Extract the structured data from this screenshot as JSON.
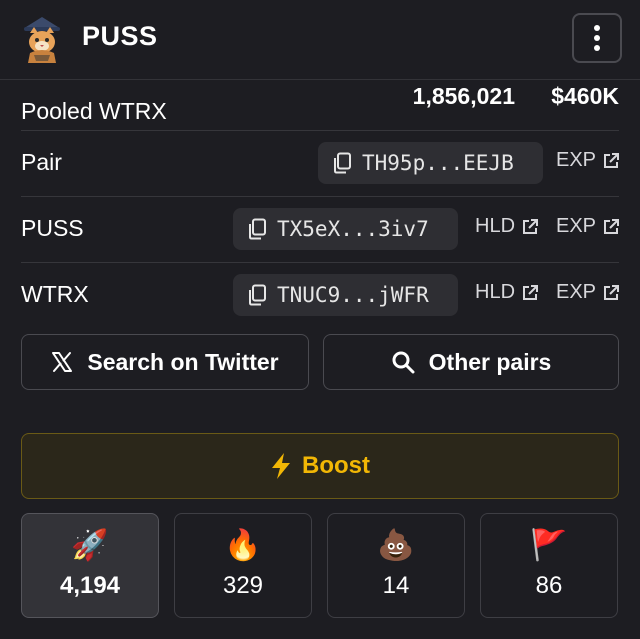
{
  "header": {
    "brand": "PUSS",
    "logo_icon": "cat-wizard-avatar",
    "menu_icon": "kebab-menu-icon"
  },
  "pooled": {
    "label": "Pooled WTRX",
    "amount": "1,856,021",
    "usd": "$460K"
  },
  "rows": {
    "pair": {
      "label": "Pair",
      "address": "TH95p...EEJB",
      "exp": "EXP"
    },
    "puss": {
      "label": "PUSS",
      "address": "TX5eX...3iv7",
      "hld": "HLD",
      "exp": "EXP"
    },
    "wtrx": {
      "label": "WTRX",
      "address": "TNUC9...jWFR",
      "hld": "HLD",
      "exp": "EXP"
    }
  },
  "actions": {
    "twitter": "Search on Twitter",
    "other_pairs": "Other pairs"
  },
  "boost": {
    "label": "Boost",
    "color": "#f2b705"
  },
  "reactions": [
    {
      "emoji": "🚀",
      "icon": "rocket-icon",
      "count": "4,194"
    },
    {
      "emoji": "🔥",
      "icon": "fire-icon",
      "count": "329"
    },
    {
      "emoji": "💩",
      "icon": "poop-icon",
      "count": "14"
    },
    {
      "emoji": "🚩",
      "icon": "red-flag-icon",
      "count": "86"
    }
  ]
}
